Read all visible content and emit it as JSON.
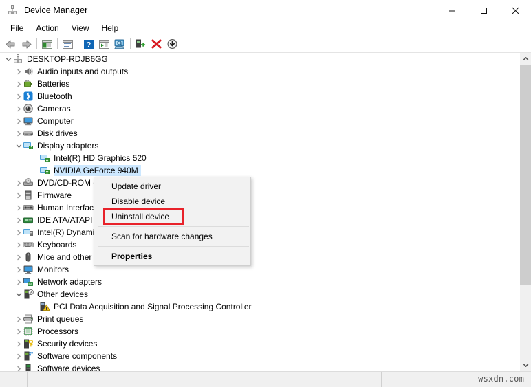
{
  "window": {
    "title": "Device Manager",
    "icon": "device-manager-icon",
    "buttons": {
      "minimize": "minimize-icon",
      "maximize": "maximize-icon",
      "close": "close-icon"
    }
  },
  "menubar": {
    "items": [
      {
        "label": "File"
      },
      {
        "label": "Action"
      },
      {
        "label": "View"
      },
      {
        "label": "Help"
      }
    ]
  },
  "toolbar": {
    "buttons": [
      {
        "name": "back-icon",
        "tooltip": "Back"
      },
      {
        "name": "forward-icon",
        "tooltip": "Forward"
      },
      {
        "name": "show-hide-console-tree-icon",
        "tooltip": "Show/Hide Console Tree"
      },
      {
        "name": "properties-icon",
        "tooltip": "Properties"
      },
      {
        "name": "help-icon",
        "tooltip": "Help"
      },
      {
        "name": "update-driver-icon",
        "tooltip": "Update Driver Software"
      },
      {
        "name": "scan-for-hardware-changes-icon",
        "tooltip": "Scan for hardware changes"
      },
      {
        "name": "enable-device-icon",
        "tooltip": "Enable device"
      },
      {
        "name": "uninstall-device-icon",
        "tooltip": "Uninstall device"
      },
      {
        "name": "disable-device-icon",
        "tooltip": "Disable device"
      }
    ]
  },
  "tree": {
    "nodes": [
      {
        "label": "DESKTOP-RDJB6GG",
        "icon": "computer-root-icon",
        "indent": 0,
        "expander": "expanded",
        "selected": false
      },
      {
        "label": "Audio inputs and outputs",
        "icon": "speaker-icon",
        "indent": 1,
        "expander": "collapsed",
        "selected": false
      },
      {
        "label": "Batteries",
        "icon": "battery-icon",
        "indent": 1,
        "expander": "collapsed",
        "selected": false
      },
      {
        "label": "Bluetooth",
        "icon": "bluetooth-icon",
        "indent": 1,
        "expander": "collapsed",
        "selected": false
      },
      {
        "label": "Cameras",
        "icon": "camera-icon",
        "indent": 1,
        "expander": "collapsed",
        "selected": false
      },
      {
        "label": "Computer",
        "icon": "monitor-icon",
        "indent": 1,
        "expander": "collapsed",
        "selected": false
      },
      {
        "label": "Disk drives",
        "icon": "disk-drive-icon",
        "indent": 1,
        "expander": "collapsed",
        "selected": false
      },
      {
        "label": "Display adapters",
        "icon": "display-adapter-icon",
        "indent": 1,
        "expander": "expanded",
        "selected": false
      },
      {
        "label": "Intel(R) HD Graphics 520",
        "icon": "display-adapter-icon",
        "indent": 2,
        "expander": "none",
        "selected": false
      },
      {
        "label": "NVIDIA GeForce 940M",
        "icon": "display-adapter-icon",
        "indent": 2,
        "expander": "none",
        "selected": true
      },
      {
        "label": "DVD/CD-ROM drives",
        "icon": "dvd-drive-icon",
        "indent": 1,
        "expander": "collapsed",
        "selected": false
      },
      {
        "label": "Firmware",
        "icon": "firmware-icon",
        "indent": 1,
        "expander": "collapsed",
        "selected": false
      },
      {
        "label": "Human Interface Devices",
        "icon": "hid-icon",
        "indent": 1,
        "expander": "collapsed",
        "selected": false
      },
      {
        "label": "IDE ATA/ATAPI controllers",
        "icon": "ide-controller-icon",
        "indent": 1,
        "expander": "collapsed",
        "selected": false
      },
      {
        "label": "Intel(R) Dynamic Platform and Thermal Framework",
        "icon": "intel-dptf-icon",
        "indent": 1,
        "expander": "collapsed",
        "selected": false
      },
      {
        "label": "Keyboards",
        "icon": "keyboard-icon",
        "indent": 1,
        "expander": "collapsed",
        "selected": false
      },
      {
        "label": "Mice and other pointing devices",
        "icon": "mouse-icon",
        "indent": 1,
        "expander": "collapsed",
        "selected": false
      },
      {
        "label": "Monitors",
        "icon": "monitor-icon",
        "indent": 1,
        "expander": "collapsed",
        "selected": false
      },
      {
        "label": "Network adapters",
        "icon": "network-adapter-icon",
        "indent": 1,
        "expander": "collapsed",
        "selected": false
      },
      {
        "label": "Other devices",
        "icon": "other-device-icon",
        "indent": 1,
        "expander": "expanded",
        "selected": false
      },
      {
        "label": "PCI Data Acquisition and Signal Processing Controller",
        "icon": "unknown-device-warning-icon",
        "indent": 2,
        "expander": "none",
        "selected": false
      },
      {
        "label": "Print queues",
        "icon": "printer-icon",
        "indent": 1,
        "expander": "collapsed",
        "selected": false
      },
      {
        "label": "Processors",
        "icon": "processor-icon",
        "indent": 1,
        "expander": "collapsed",
        "selected": false
      },
      {
        "label": "Security devices",
        "icon": "security-device-icon",
        "indent": 1,
        "expander": "collapsed",
        "selected": false
      },
      {
        "label": "Software components",
        "icon": "software-component-icon",
        "indent": 1,
        "expander": "collapsed",
        "selected": false
      },
      {
        "label": "Software devices",
        "icon": "software-device-icon",
        "indent": 1,
        "expander": "collapsed",
        "selected": false
      }
    ]
  },
  "context_menu": {
    "items": [
      {
        "label": "Update driver",
        "type": "item",
        "bold": false,
        "highlighted": false
      },
      {
        "label": "Disable device",
        "type": "item",
        "bold": false,
        "highlighted": false
      },
      {
        "label": "Uninstall device",
        "type": "item",
        "bold": false,
        "highlighted": true
      },
      {
        "label": "Scan for hardware changes",
        "type": "item",
        "bold": false,
        "highlighted": false
      },
      {
        "label": "Properties",
        "type": "item",
        "bold": true,
        "highlighted": false
      }
    ],
    "highlight_color": "#e8222a"
  },
  "statusbar": {
    "watermark": "wsxdn.com"
  },
  "colors": {
    "selection": "#cde8ff",
    "accent_red": "#e8222a",
    "scrollbar_thumb": "#cdcdcd",
    "chrome": "#f0f0f0"
  }
}
